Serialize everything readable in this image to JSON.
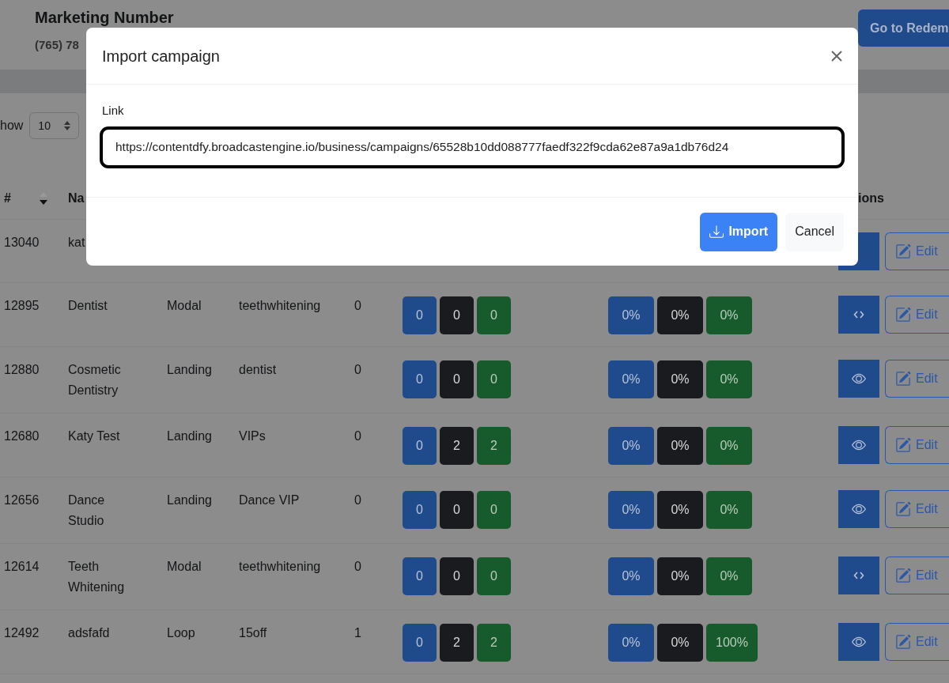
{
  "page": {
    "title": "Marketing Number",
    "phone": "(765) 78",
    "redeem_button": "Go to Redem"
  },
  "controls": {
    "show_label": "how",
    "page_size": "10"
  },
  "table": {
    "columns": [
      "#",
      "Na",
      "ions"
    ],
    "rows": [
      {
        "id": "13040",
        "name": "kat",
        "edit": "Edit"
      },
      {
        "id": "12895",
        "name": "Dentist",
        "type": "Modal",
        "keyword": "teethwhitening",
        "count": "0",
        "stats": [
          "0",
          "0",
          "0"
        ],
        "rates": [
          "0%",
          "0%",
          "0%"
        ],
        "preview": {
          "kind": "code"
        },
        "edit": "Edit"
      },
      {
        "id": "12880",
        "name": "Cosmetic Dentistry",
        "type": "Landing",
        "keyword": "dentist",
        "count": "0",
        "stats": [
          "0",
          "0",
          "0"
        ],
        "rates": [
          "0%",
          "0%",
          "0%"
        ],
        "preview": {
          "kind": "eye"
        },
        "edit": "Edit"
      },
      {
        "id": "12680",
        "name": "Katy Test",
        "type": "Landing",
        "keyword": "VIPs",
        "count": "0",
        "stats": [
          "0",
          "2",
          "2"
        ],
        "rates": [
          "0%",
          "0%",
          "0%"
        ],
        "preview": {
          "kind": "eye"
        },
        "edit": "Edit"
      },
      {
        "id": "12656",
        "name": "Dance Studio",
        "type": "Landing",
        "keyword": "Dance VIP",
        "count": "0",
        "stats": [
          "0",
          "0",
          "0"
        ],
        "rates": [
          "0%",
          "0%",
          "0%"
        ],
        "preview": {
          "kind": "eye"
        },
        "edit": "Edit"
      },
      {
        "id": "12614",
        "name": "Teeth Whitening",
        "type": "Modal",
        "keyword": "teethwhitening",
        "count": "0",
        "stats": [
          "0",
          "0",
          "0"
        ],
        "rates": [
          "0%",
          "0%",
          "0%"
        ],
        "preview": {
          "kind": "code"
        },
        "edit": "Edit"
      },
      {
        "id": "12492",
        "name": "adsfafd",
        "type": "Loop",
        "keyword": "15off",
        "count": "1",
        "stats": [
          "0",
          "2",
          "2"
        ],
        "rates": [
          "0%",
          "0%",
          "100%"
        ],
        "preview": {
          "kind": "eye"
        },
        "edit": "Edit"
      }
    ]
  },
  "modal": {
    "title": "Import campaign",
    "field_label": "Link",
    "link_value": "https://contentdfy.broadcastengine.io/business/campaigns/65528b10dd088777faedf322f9cda62e87a9a1db76d24",
    "focused": true,
    "buttons": [
      {
        "label": "Import",
        "kind": "primary"
      },
      {
        "label": "Cancel",
        "kind": "secondary"
      }
    ]
  }
}
